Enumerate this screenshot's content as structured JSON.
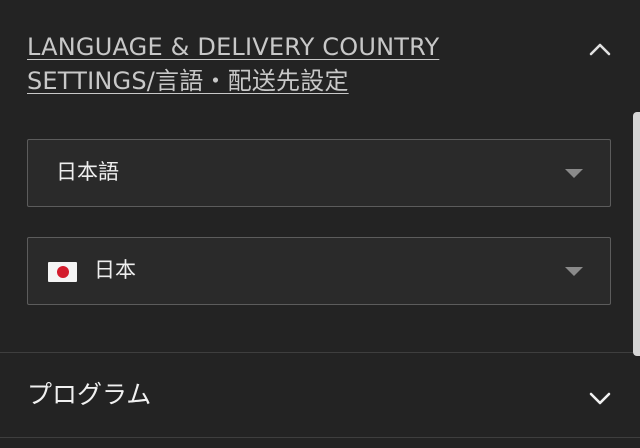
{
  "language_section": {
    "title": "LANGUAGE & DELIVERY COUNTRY SETTINGS/言語・配送先設定",
    "expanded": true,
    "toggle_icon": "chevron-up-icon"
  },
  "language_select": {
    "selected": "日本語",
    "icon": "caret-down-icon"
  },
  "country_select": {
    "selected": "日本",
    "flag": "japan-flag-icon",
    "icon": "caret-down-icon"
  },
  "program_section": {
    "title": "プログラム",
    "expanded": false,
    "toggle_icon": "chevron-down-icon"
  },
  "colors": {
    "background": "#232323",
    "border": "#5c5c5c",
    "text": "#e6e6e6",
    "flag_red": "#d31b2c"
  }
}
